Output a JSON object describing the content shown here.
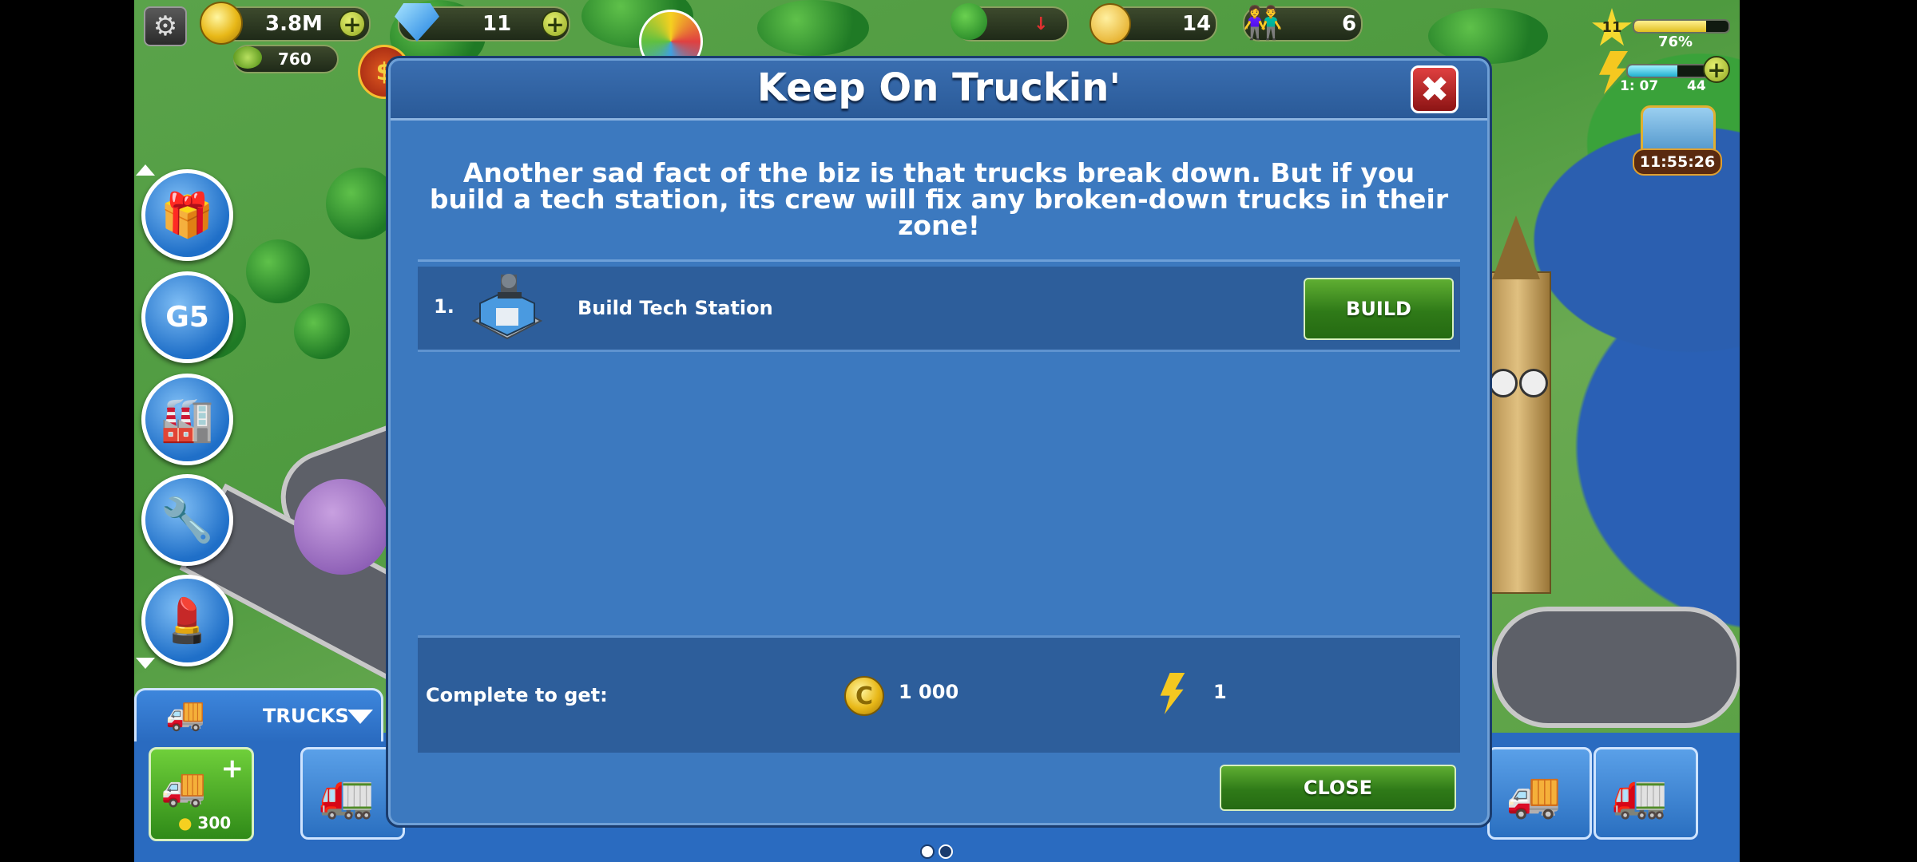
{
  "hud": {
    "coins": "3.8M",
    "cash": "760",
    "gems": "11",
    "happiness": "14",
    "population": "6",
    "level": "11",
    "xp_percent_text": "76%",
    "xp_fraction": 0.76,
    "energy_timer": "1: 07",
    "energy_value": "44",
    "energy_fraction": 0.55,
    "chest_timer": "11:55:26"
  },
  "modal": {
    "title": "Keep On Truckin'",
    "description": "Another sad fact of the biz is that trucks break down. But if you build a tech station, its crew will fix any broken-down trucks in their zone!",
    "task": {
      "number": "1.",
      "label": "Build Tech Station",
      "button": "BUILD"
    },
    "reward": {
      "label": "Complete to get:",
      "coins_value": "1 000",
      "energy_value": "1"
    },
    "close_button": "CLOSE"
  },
  "bottom": {
    "tab_label": "TRUCKS",
    "add_truck_cost": "300"
  },
  "colors": {
    "modal_bg": "#3c79bf",
    "row_bg": "#2d5e9b",
    "button_green": "#3f8f22"
  }
}
